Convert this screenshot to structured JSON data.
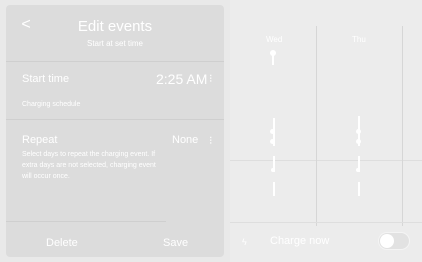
{
  "header": {
    "back_glyph": "<",
    "title": "Edit events",
    "subtitle": "Start at set time"
  },
  "start_time": {
    "label": "Start time",
    "value": "2:25 AM",
    "stepper_glyph": "⁝",
    "section_caption": "Charging schedule"
  },
  "repeat": {
    "label": "Repeat",
    "value": "None",
    "stepper_glyph": "⁝",
    "description_line1": "Select days to repeat the charging event. If",
    "description_line2": "extra days are not selected, charging event",
    "description_line3": "will occur once."
  },
  "actions": {
    "delete_label": "Delete",
    "save_label": "Save"
  },
  "schedule": {
    "days": [
      "Wed",
      "Thu"
    ]
  },
  "charge_now": {
    "label": "Charge now",
    "icon_glyph": "ϟ",
    "toggle_on": false
  },
  "colors": {
    "panel_bg": "#dcdcdc",
    "screen_bg": "#e9e9e9",
    "text": "#ffffff"
  }
}
